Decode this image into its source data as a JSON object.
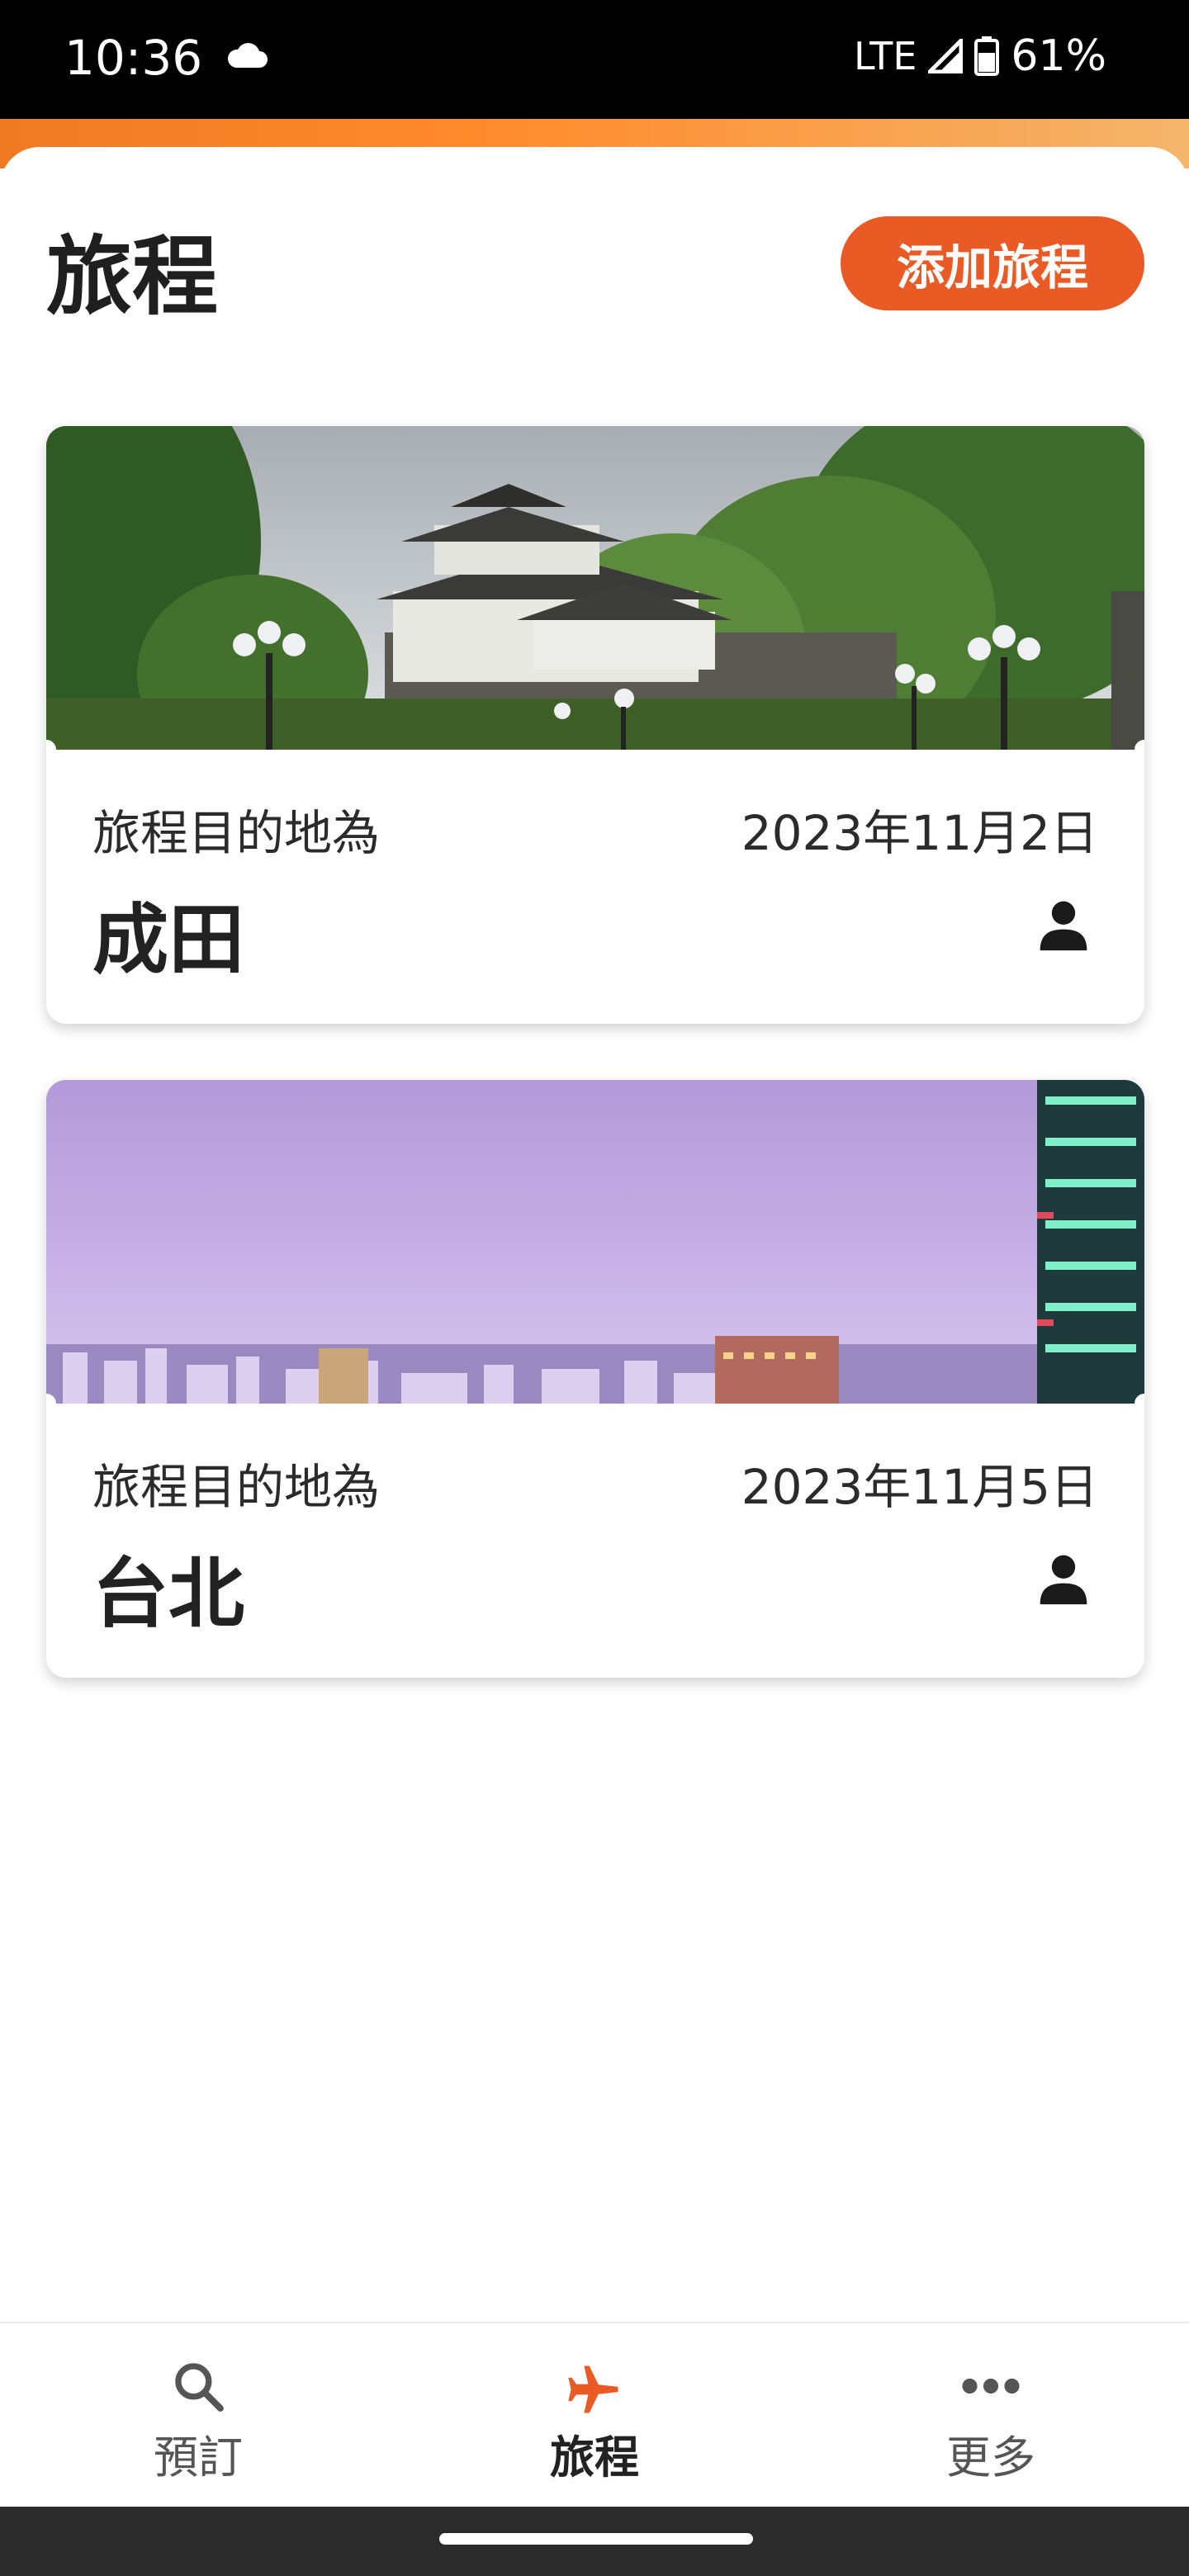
{
  "status_bar": {
    "time": "10:36",
    "network": "LTE",
    "battery": "61%"
  },
  "header": {
    "title": "旅程",
    "add_trip_label": "添加旅程"
  },
  "trips": [
    {
      "label": "旅程目的地為",
      "date": "2023年11月2日",
      "city": "成田"
    },
    {
      "label": "旅程目的地為",
      "date": "2023年11月5日",
      "city": "台北"
    }
  ],
  "bottom_nav": [
    {
      "label": "預訂",
      "icon": "search-icon"
    },
    {
      "label": "旅程",
      "icon": "airplane-icon",
      "active": true
    },
    {
      "label": "更多",
      "icon": "more-icon"
    }
  ],
  "colors": {
    "accent": "#ea5a24",
    "band": "#f07a24"
  }
}
